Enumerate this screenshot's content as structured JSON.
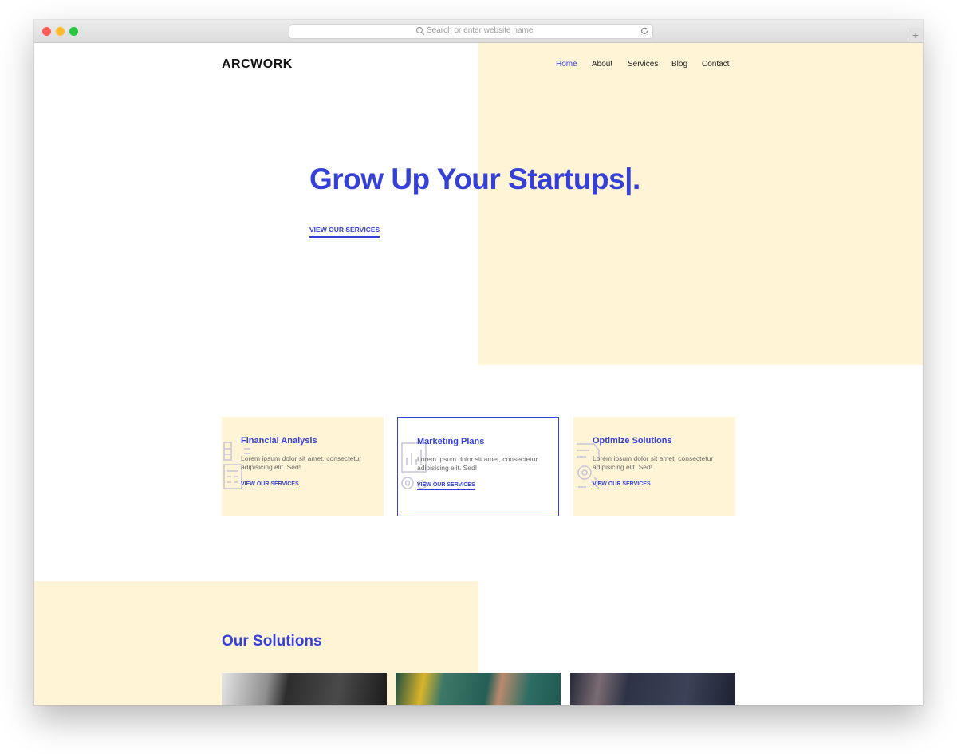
{
  "browser": {
    "url_placeholder": "Search or enter website name",
    "new_tab_label": "+"
  },
  "site": {
    "logo": "ARCWORK",
    "nav": [
      "Home",
      "About",
      "Services",
      "Blog",
      "Contact"
    ],
    "active_nav": "Home"
  },
  "hero": {
    "title": "Grow Up Your Startups|.",
    "link": "VIEW OUR SERVICES"
  },
  "cards": [
    {
      "title": "Financial Analysis",
      "text": "Lorem ipsum dolor sit amet, consectetur adipisicing elit. Sed!",
      "link": "VIEW OUR SERVICES",
      "icon": "calculator-icon"
    },
    {
      "title": "Marketing Plans",
      "text": "Lorem ipsum dolor sit amet, consectetur adipisicing elit. Sed!",
      "link": "VIEW OUR SERVICES",
      "icon": "chart-gear-icon"
    },
    {
      "title": "Optimize Solutions",
      "text": "Lorem ipsum dolor sit amet, consectetur adipisicing elit. Sed!",
      "link": "VIEW OUR SERVICES",
      "icon": "cogs-icon"
    }
  ],
  "solutions": {
    "title": "Our Solutions"
  },
  "colors": {
    "accent": "#3440d7",
    "cream": "#fff5d6"
  }
}
